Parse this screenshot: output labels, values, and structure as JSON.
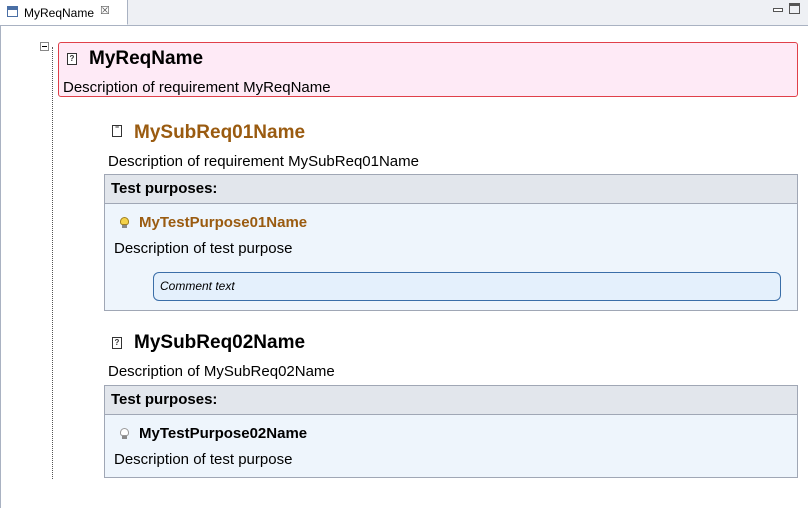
{
  "tab": {
    "label": "MyReqName",
    "close_glyph": "☒",
    "icon": "editor-icon"
  },
  "requirement": {
    "icon": "requirement-icon",
    "icon_glyph": "?",
    "title": "MyReqName",
    "description": "Description of requirement MyReqName"
  },
  "subreqs": [
    {
      "icon": "document-icon",
      "title": "MySubReq01Name",
      "description": "Description of requirement MySubReq01Name",
      "test_purposes_header": "Test purposes:",
      "purpose": {
        "icon": "lightbulb-on-icon",
        "title": "MyTestPurpose01Name",
        "description": "Description of test purpose",
        "comment": "Comment text"
      }
    },
    {
      "icon": "requirement-icon",
      "icon_glyph": "?",
      "title": "MySubReq02Name",
      "description": "Description of MySubReq02Name",
      "test_purposes_header": "Test purposes:",
      "purpose": {
        "icon": "lightbulb-off-icon",
        "title": "MyTestPurpose02Name",
        "description": "Description of test purpose"
      }
    }
  ],
  "colors": {
    "req_background": "#feeaf6",
    "req_border": "#e0404a",
    "subreq_title_brown": "#9a5b10",
    "panel_background": "#eef5fc",
    "comment_border": "#3a6ea8"
  }
}
